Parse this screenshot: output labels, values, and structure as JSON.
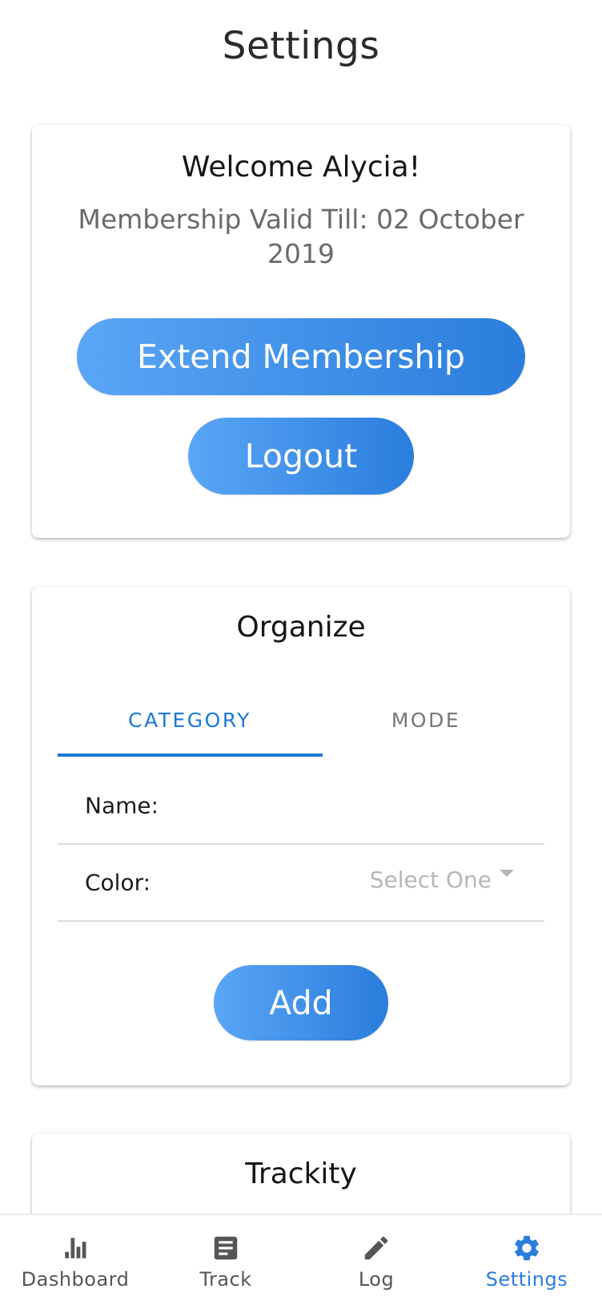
{
  "header": {
    "title": "Settings"
  },
  "account": {
    "welcome": "Welcome Alycia!",
    "membership_text": "Membership Valid Till: 02 October 2019",
    "extend_label": "Extend Membership",
    "logout_label": "Logout"
  },
  "organize": {
    "title": "Organize",
    "tabs": [
      {
        "label": "CATEGORY",
        "active": true
      },
      {
        "label": "MODE",
        "active": false
      }
    ],
    "form": {
      "name_label": "Name:",
      "name_value": "",
      "color_label": "Color:",
      "color_placeholder": "Select One"
    },
    "add_label": "Add"
  },
  "trackity": {
    "title": "Trackity"
  },
  "bottom_nav": {
    "active_color": "#2a7ddc",
    "inactive_color": "#555555",
    "items": [
      {
        "label": "Dashboard",
        "icon": "bar-chart-icon",
        "active": false
      },
      {
        "label": "Track",
        "icon": "notes-icon",
        "active": false
      },
      {
        "label": "Log",
        "icon": "pencil-icon",
        "active": false
      },
      {
        "label": "Settings",
        "icon": "gear-icon",
        "active": true
      }
    ]
  },
  "theme": {
    "accent": "#1f78d6",
    "button_gradient_start": "#5aa6f6",
    "button_gradient_end": "#2a7ddc"
  }
}
